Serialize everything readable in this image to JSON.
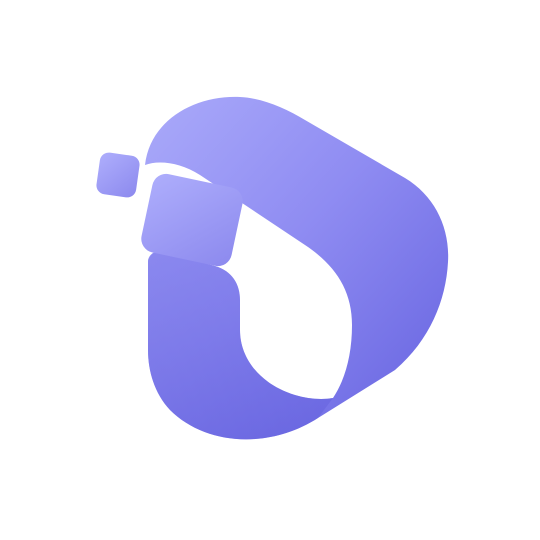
{
  "logo": {
    "icon_name": "app-logo-icon",
    "colors": {
      "background": "#ffffff",
      "gradient_light": "#aaaafa",
      "gradient_mid": "#8f8cf2",
      "gradient_dark": "#6461df",
      "square_light": "#aeaefc",
      "square_dark": "#8c89ee"
    }
  }
}
